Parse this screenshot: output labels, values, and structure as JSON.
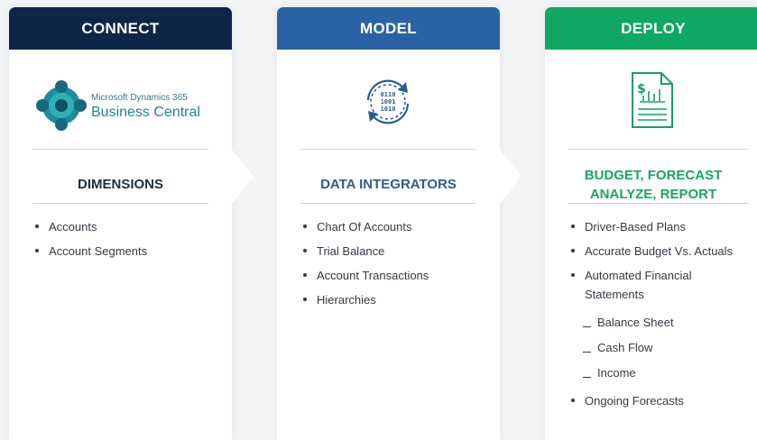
{
  "columns": {
    "connect": {
      "header": "CONNECT",
      "logo": {
        "icon": "dynamics-365-logo-icon",
        "line1": "Microsoft Dynamics 365",
        "line2": "Business Central"
      },
      "title": "DIMENSIONS",
      "items": [
        "Accounts",
        "Account Segments"
      ]
    },
    "model": {
      "header": "MODEL",
      "icon": "data-sync-icon",
      "title": "DATA INTEGRATORS",
      "items": [
        "Chart Of Accounts",
        "Trial Balance",
        "Account Transactions",
        "Hierarchies"
      ]
    },
    "deploy": {
      "header": "DEPLOY",
      "icon": "financial-report-icon",
      "title_line1": "BUDGET, FORECAST",
      "title_line2": "ANALYZE, REPORT",
      "items": [
        "Driver-Based Plans",
        "Accurate Budget Vs. Actuals",
        "Automated Financial Statements",
        "Ongoing Forecasts"
      ],
      "sub_items": [
        "Balance Sheet",
        "Cash Flow",
        "Income"
      ]
    }
  },
  "colors": {
    "connect": "#0d2547",
    "model": "#2a63a5",
    "deploy": "#0ea862",
    "teal": "#2aa3a6"
  }
}
